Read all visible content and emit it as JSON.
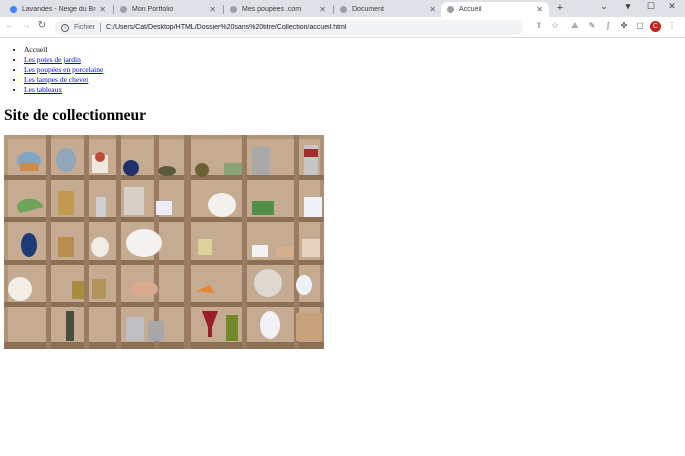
{
  "browser": {
    "tabs": [
      {
        "title": "Lavandes - Neige du Bre...",
        "active": false,
        "fav_color": "#4285f4"
      },
      {
        "title": "Mon Portfolio",
        "active": false,
        "fav_color": "#9aa0a6"
      },
      {
        "title": "Mes poupees .com",
        "active": false,
        "fav_color": "#9aa0a6"
      },
      {
        "title": "Document",
        "active": false,
        "fav_color": "#9aa0a6"
      },
      {
        "title": "Accueil",
        "active": true,
        "fav_color": "#9aa0a6"
      }
    ],
    "protocol_label": "Fichier",
    "url": "C:/Users/Cat/Desktop/HTML/Dossier%20sans%20titre/Collection/accueil.html",
    "profile_initial": "C"
  },
  "page": {
    "menu": [
      {
        "label": "Accueil",
        "is_link": false
      },
      {
        "label": "Les potes de jardin",
        "is_link": true
      },
      {
        "label": "Les poupées en porcelaine",
        "is_link": true
      },
      {
        "label": "Les lampes de chevet",
        "is_link": true
      },
      {
        "label": "Les tableaux",
        "is_link": true
      }
    ],
    "heading": "Site de collectionneur",
    "photo_alt": "Étagère de collectionneur avec miniatures"
  }
}
